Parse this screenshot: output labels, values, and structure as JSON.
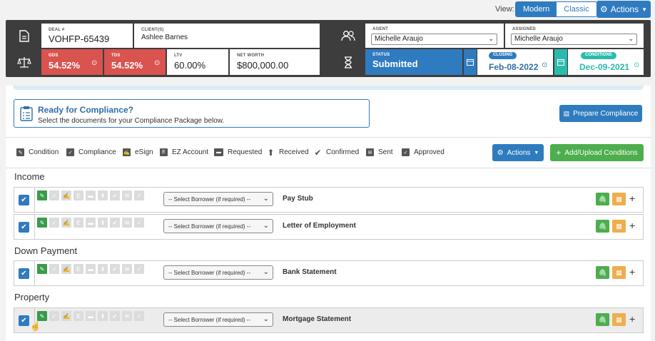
{
  "topbar": {
    "view_label": "View:",
    "view_modern": "Modern",
    "view_classic": "Classic",
    "actions_label": "Actions",
    "actions_icon": "gear-icon"
  },
  "deal": {
    "deal_label": "DEAL #",
    "deal_value": "VOHFP-65439",
    "client_label": "CLIENT(S)",
    "client_value": "Ashlee Barnes",
    "gds_label": "GDS",
    "gds_value": "54.52%",
    "tds_label": "TDS",
    "tds_value": "54.52%",
    "ltv_label": "LTV",
    "ltv_value": "60.00%",
    "networth_label": "NET WORTH",
    "networth_value": "$800,000.00"
  },
  "people": {
    "agent_label": "AGENT",
    "agent_value": "Michelle Araujo",
    "assigned_label": "ASSIGNED",
    "assigned_value": "Michelle Araujo"
  },
  "status": {
    "status_label": "STATUS",
    "status_value": "Submitted",
    "closing_label": "CLOSING",
    "closing_value": "Feb-08-2022",
    "conditions_label": "CONDITIONS",
    "conditions_value": "Dec-09-2021"
  },
  "compliance": {
    "title": "Ready for Compliance?",
    "subtitle": "Select the documents for your Compliance Package below.",
    "prepare_button": "Prepare Compliance"
  },
  "legend": [
    "Condition",
    "Compliance",
    "eSign",
    "EZ Account",
    "Requested",
    "Received",
    "Confirmed",
    "Sent",
    "Approved"
  ],
  "toolbar": {
    "actions_label": "Actions",
    "add_upload_label": "Add/Upload Conditions"
  },
  "sections": {
    "income": "Income",
    "down_payment": "Down Payment",
    "property": "Property"
  },
  "rows": [
    {
      "doc": "Pay Stub",
      "borrower_placeholder": "-- Select Borrower (if required) --"
    },
    {
      "doc": "Letter of Employment",
      "borrower_placeholder": "-- Select Borrower (if required) --"
    },
    {
      "doc": "Bank Statement",
      "borrower_placeholder": "-- Select Borrower (if required) --"
    },
    {
      "doc": "Mortgage Statement",
      "borrower_placeholder": "-- Select Borrower (if required) --"
    }
  ],
  "colors": {
    "primary": "#2f7bbf",
    "danger": "#d9534f",
    "success": "#4cae4c",
    "warning": "#f0ad4e",
    "teal": "#2bbbad",
    "header_dark": "#3d3d3d"
  }
}
